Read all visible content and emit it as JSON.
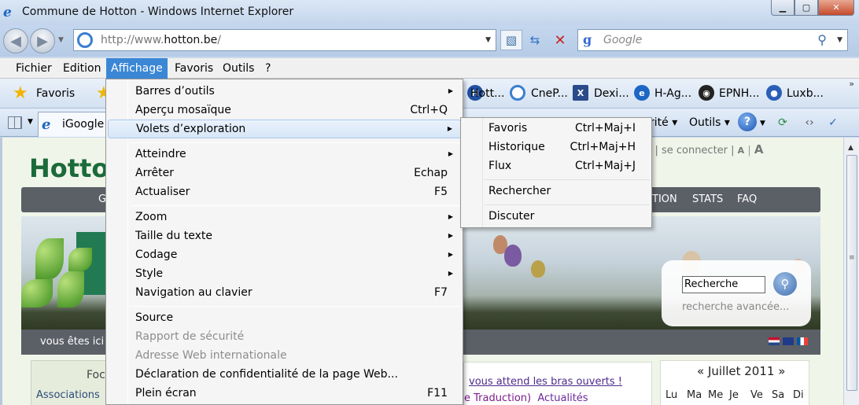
{
  "window": {
    "title": "Commune de Hotton - Windows Internet Explorer",
    "min": "▁",
    "max": "▢",
    "close": "✕"
  },
  "address": {
    "url_prefix": "http://www.",
    "url_domain": "hotton.be",
    "url_suffix": "/",
    "search_placeholder": "Google"
  },
  "menubar": [
    "Fichier",
    "Edition",
    "Affichage",
    "Favoris",
    "Outils",
    "?"
  ],
  "favorites_bar": {
    "favoris_label": "Favoris",
    "links": [
      "Hott...",
      "CneP...",
      "Dexi...",
      "H-Ag...",
      "EPNH...",
      "Luxb..."
    ]
  },
  "command_bar": {
    "tab_label": "iGoogle",
    "securite": "rité ▾",
    "outils": "Outils ▾"
  },
  "view_menu": [
    {
      "label": "Barres d’outils",
      "shortcut": "",
      "submenu": true
    },
    {
      "label": "Aperçu mosaïque",
      "shortcut": "Ctrl+Q"
    },
    {
      "label": "Volets d’exploration",
      "shortcut": "",
      "submenu": true,
      "highlighted": true
    },
    {
      "label": "Atteindre",
      "shortcut": "",
      "submenu": true
    },
    {
      "label": "Arrêter",
      "shortcut": "Echap"
    },
    {
      "label": "Actualiser",
      "shortcut": "F5"
    },
    {
      "label": "Zoom",
      "shortcut": "",
      "submenu": true
    },
    {
      "label": "Taille du texte",
      "shortcut": "",
      "submenu": true
    },
    {
      "label": "Codage",
      "shortcut": "",
      "submenu": true
    },
    {
      "label": "Style",
      "shortcut": "",
      "submenu": true
    },
    {
      "label": "Navigation au clavier",
      "shortcut": "F7"
    },
    {
      "label": "Source",
      "shortcut": ""
    },
    {
      "label": "Rapport de sécurité",
      "shortcut": "",
      "disabled": true
    },
    {
      "label": "Adresse Web internationale",
      "shortcut": "",
      "disabled": true
    },
    {
      "label": "Déclaration de confidentialité de la page Web...",
      "shortcut": ""
    },
    {
      "label": "Plein écran",
      "shortcut": "F11"
    }
  ],
  "explorer_submenu": [
    {
      "label": "Favoris",
      "shortcut": "Ctrl+Maj+I"
    },
    {
      "label": "Historique",
      "shortcut": "Ctrl+Maj+H"
    },
    {
      "label": "Flux",
      "shortcut": "Ctrl+Maj+J"
    },
    {
      "label": "Rechercher",
      "shortcut": ""
    },
    {
      "label": "Discuter",
      "shortcut": ""
    }
  ],
  "page": {
    "logo": "Hotton",
    "top_nav": "tact | se connecter | ",
    "font_small": "A",
    "font_large": "A",
    "nav_items": [
      "GA",
      "TION",
      "STATS",
      "FAQ"
    ],
    "search_value": "Recherche",
    "search_adv": "recherche avancée...",
    "breadcrumb": "vous êtes ici :",
    "focus_title": "Focu",
    "focus_sub": "Associations",
    "news_line1": "vous attend les bras ouverts !",
    "news_line2_a": "e Traduction)",
    "news_line2_b": "Actualités",
    "calendar_title": "« Juillet 2011 »",
    "calendar_days": [
      "Lu",
      "Ma",
      "Me",
      "Je",
      "Ve",
      "Sa",
      "Di"
    ]
  },
  "colors": {
    "menu_highlight": "#3b87d5",
    "nav_bg": "#5b5f66",
    "logo_green": "#1b6b3a"
  }
}
